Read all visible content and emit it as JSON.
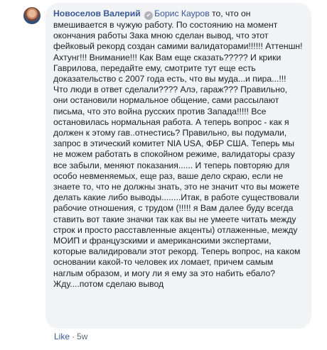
{
  "comment": {
    "author": "Новоселов Валерий",
    "mention": "Борис Кауров",
    "text": "то, что он вмешивается в чужую работу. По состоянию на момент окончания работы Зака мною сделан вывод, что этот фейковый рекорд создан самими валидаторами!!!!!! Аттеншн! Ахтунг!!! Внимание!!! Как Вам еще сказать????? И крики Гаврилова, передайте ему, смотрите тут еще есть доказательство с 2007 года есть, что вы муда...и пира...!!! Что люди в ответ сделали???? Алэ, гараж??? Правильно, они остановили нормальное общение, сами рассылают письма, что это война русских против Запада!!!!! Все остановилась нормальная работа. А теперь вопрос - как я должен к этому гав..отнестись? Правильно, вы подумали, запрос в этический комитет NIA USA, ФБР США. Теперь мы не можем работать в спокойном режиме, валидаторы сразу все забыли, меняют показания...... И теперь повторяю для особо невменяемых, еще раз, ваше дело скраю, если не знаете то, что не должны знать, это не значит что вы можете делать какие либо выводы........Итак, в работе существовали рабочие отношения, с трудом (!!!!! я Вам далее буду всегда ставить вот такие значки так как вы не умеете читать между строк и просто расставленные акценты) отлаженные, между МОИП и французскими и американскими экспертами, которые валидировали этот рекорд. Теперь вопрос, на каком основании какой-то человек их ломает, причем самым наглым образом, и могу ли я ему за это набить ебало? Жду....потом сделаю вывод"
  },
  "actions": {
    "like": "Like",
    "separator": "·",
    "time": "5w"
  }
}
